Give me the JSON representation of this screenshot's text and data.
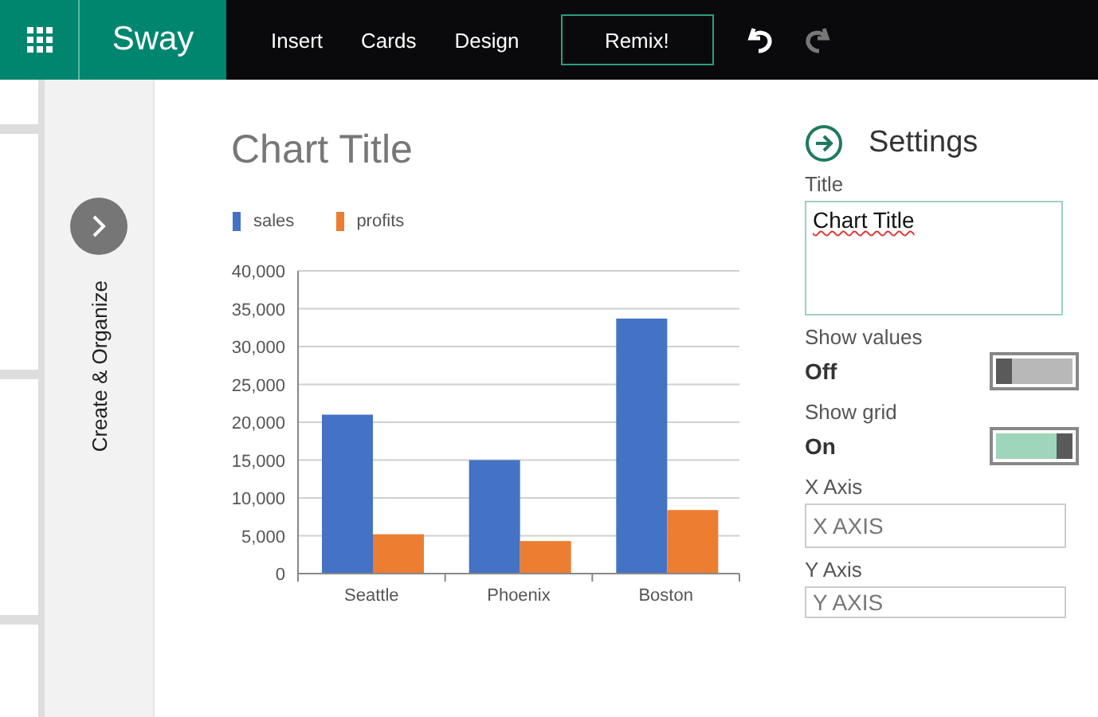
{
  "app": {
    "name": "Sway"
  },
  "nav": [
    {
      "label": "Insert"
    },
    {
      "label": "Cards"
    },
    {
      "label": "Design"
    }
  ],
  "remix": {
    "label": "Remix!"
  },
  "history": [
    {
      "kind": "undo",
      "disabled": false
    },
    {
      "kind": "redo",
      "disabled": true
    }
  ],
  "sidebar": {
    "label": "Create & Organize"
  },
  "chart": {
    "title": "Chart Title",
    "chart_data": {
      "type": "bar",
      "categories": [
        "Seattle",
        "Phoenix",
        "Boston"
      ],
      "series": [
        {
          "name": "sales",
          "color": "#4472c4",
          "values": [
            21000,
            15000,
            33700
          ]
        },
        {
          "name": "profits",
          "color": "#ed7d31",
          "values": [
            5200,
            4300,
            8400
          ]
        }
      ],
      "ylim": [
        0,
        40000
      ],
      "grid": true,
      "yticks": [
        {
          "value": 0,
          "label": "0"
        },
        {
          "value": 5000,
          "label": "5,000"
        },
        {
          "value": 10000,
          "label": "10,000"
        },
        {
          "value": 15000,
          "label": "15,000"
        },
        {
          "value": 20000,
          "label": "20,000"
        },
        {
          "value": 25000,
          "label": "25,000"
        },
        {
          "value": 30000,
          "label": "30,000"
        },
        {
          "value": 35000,
          "label": "35,000"
        },
        {
          "value": 40000,
          "label": "40,000"
        }
      ]
    }
  },
  "settings": {
    "heading": "Settings",
    "title_label": "Title",
    "title_value": "Chart Title",
    "toggles": [
      {
        "label": "Show values",
        "state_text": "Off",
        "on": false
      },
      {
        "label": "Show grid",
        "state_text": "On",
        "on": true
      }
    ],
    "axes": [
      {
        "label": "X Axis",
        "placeholder": "X AXIS"
      },
      {
        "label": "Y Axis",
        "placeholder": "Y AXIS"
      }
    ]
  }
}
